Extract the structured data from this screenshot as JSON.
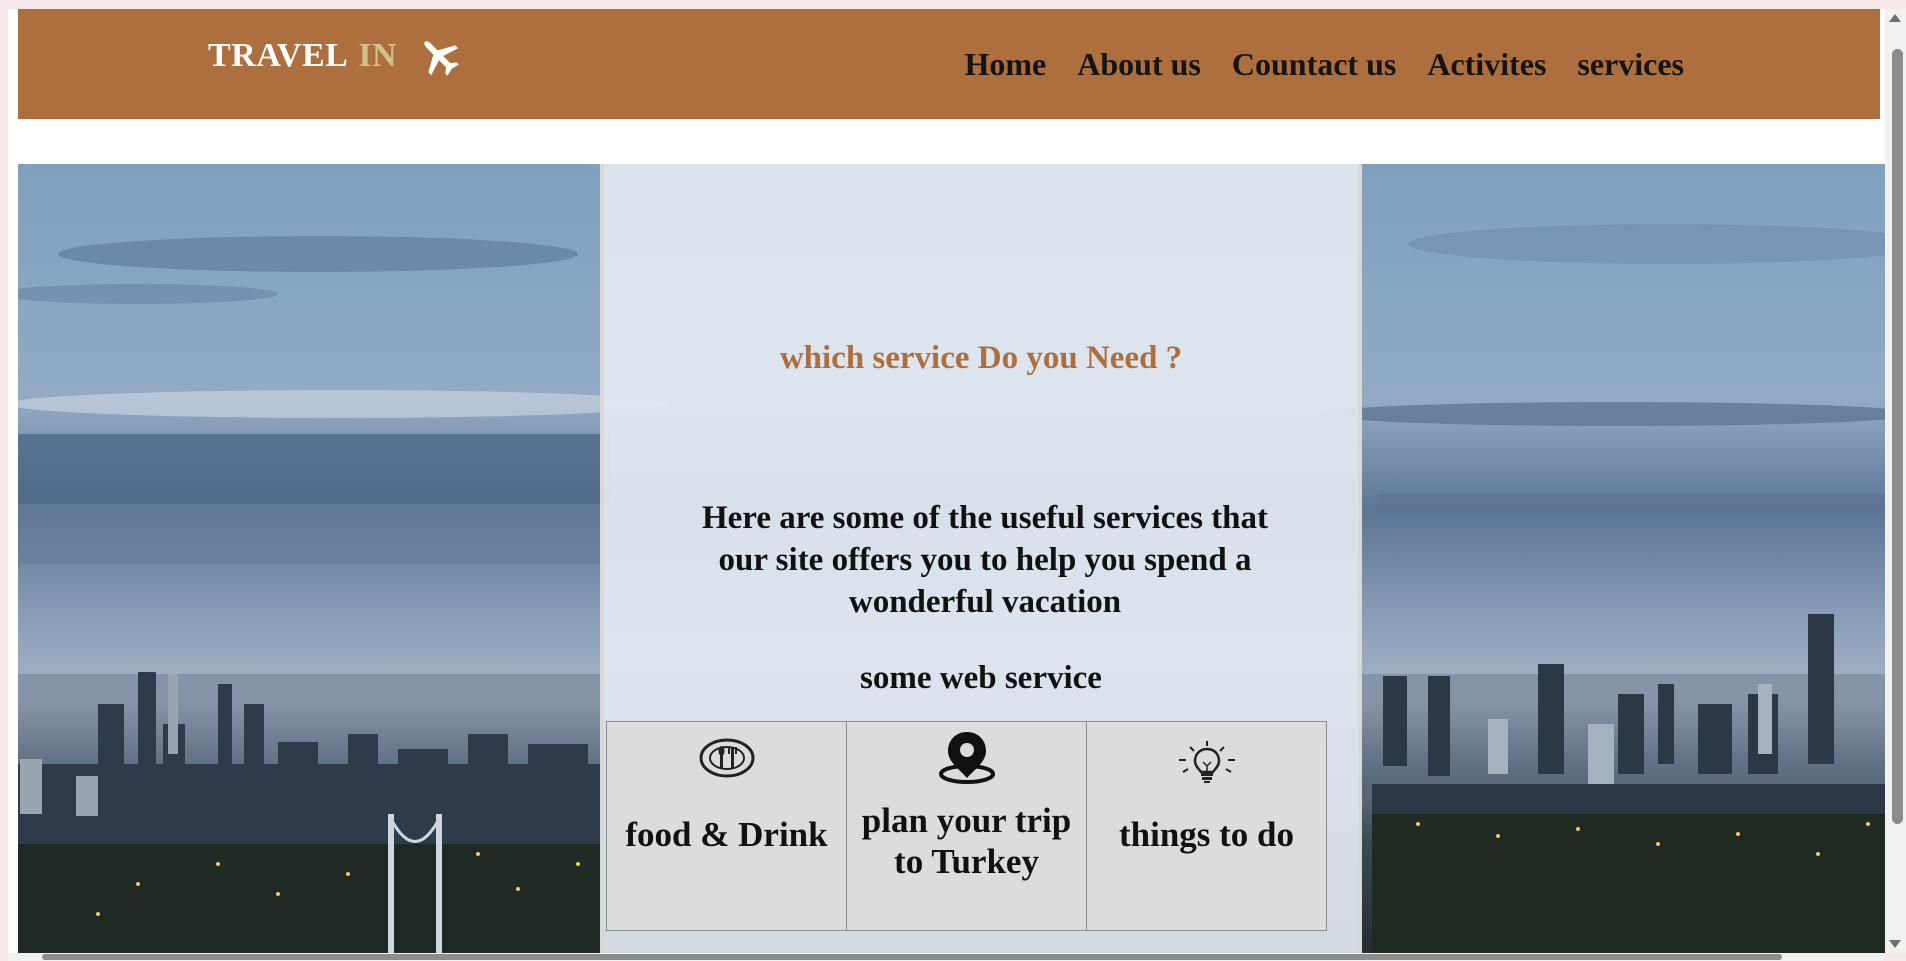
{
  "brand": {
    "name_main": "TRAVEL",
    "name_accent": "IN",
    "icon": "airplane-icon"
  },
  "nav": {
    "items": [
      "Home",
      "About us",
      "Countact us",
      "Activites",
      "services"
    ]
  },
  "services": {
    "title": "which service Do you Need ?",
    "description": "Here are some of the useful services that our site offers you to help you spend a wonderful vacation",
    "subtitle": "some web service",
    "cards": [
      {
        "label": "food & Drink",
        "icon": "plate-cutlery-icon"
      },
      {
        "label": "plan your trip to Turkey",
        "icon": "location-pin-icon"
      },
      {
        "label": "things to do",
        "icon": "lightbulb-icon"
      }
    ]
  },
  "colors": {
    "brand": "#ad6f3d",
    "brand_accent": "#d2c08f",
    "card_bg": "#dcdcdc"
  }
}
